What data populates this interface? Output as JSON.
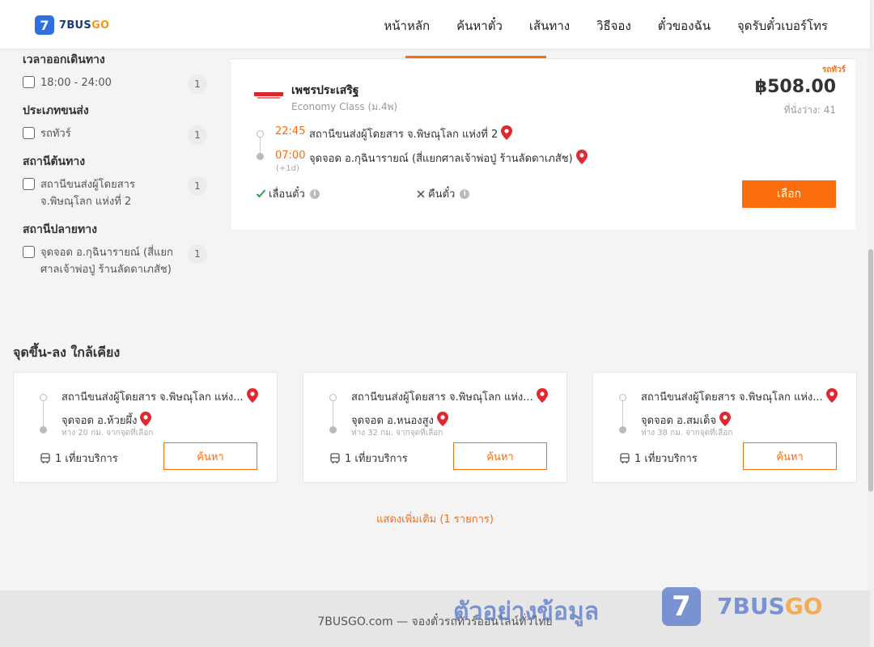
{
  "header": {
    "logo_mark": "7",
    "logo_text": "7BUS",
    "logo_text_go": "GO",
    "nav": [
      "หน้าหลัก",
      "ค้นหาตั๋ว",
      "เส้นทาง",
      "วิธีจอง",
      "ตั๋วของฉัน",
      "จุดรับตั๋วเบอร์โทร"
    ]
  },
  "filters": {
    "departure_time": {
      "title": "เวลาออกเดินทาง",
      "options": [
        {
          "label": "18:00 - 24:00",
          "count": "1"
        }
      ]
    },
    "transport_type": {
      "title": "ประเภทขนส่ง",
      "options": [
        {
          "label": "รถทัวร์",
          "count": "1"
        }
      ]
    },
    "origin_station": {
      "title": "สถานีต้นทาง",
      "options": [
        {
          "label": "สถานีขนส่งผู้โดยสาร จ.พิษณุโลก แห่งที่ 2",
          "count": "1"
        }
      ]
    },
    "destination_station": {
      "title": "สถานีปลายทาง",
      "options": [
        {
          "label": "จุดจอด อ.กุฉินารายณ์ (สี่แยกศาลเจ้าพ่อปู่ ร้านลัดดาเภสัช)",
          "count": "1"
        }
      ]
    }
  },
  "trip": {
    "tag": "รถทัวร์",
    "operator": "เพชรประเสริฐ",
    "bus_class": "Economy Class (ม.4พ)",
    "price": "฿508.00",
    "seats": "ที่นั่งว่าง: 41",
    "depart_time": "22:45",
    "depart_stop": "สถานีขนส่งผู้โดยสาร จ.พิษณุโลก แห่งที่ 2",
    "arrive_time": "07:00",
    "arrive_next_day": "(+1d)",
    "arrive_stop": "จุดจอด อ.กุฉินารายณ์ (สี่แยกศาลเจ้าพ่อปู่ ร้านลัดดาเภสัช)",
    "reschedule": "เลื่อนตั๋ว",
    "refund": "คืนตั๋ว",
    "select_label": "เลือก",
    "brand_color": "#f96d0e"
  },
  "nearby": {
    "title": "จุดขึ้น-ลง ใกล้เคียง",
    "cards": [
      {
        "origin": "สถานีขนส่งผู้โดยสาร จ.พิษณุโลก แห่ง...",
        "dest": "จุดจอด อ.ห้วยผึ้ง",
        "distance": "ห่าง 20 กม. จากจุดที่เลือก",
        "trips": "1 เที่ยวบริการ",
        "button": "ค้นหา"
      },
      {
        "origin": "สถานีขนส่งผู้โดยสาร จ.พิษณุโลก แห่ง...",
        "dest": "จุดจอด อ.หนองสูง",
        "distance": "ห่าง 32 กม. จากจุดที่เลือก",
        "trips": "1 เที่ยวบริการ",
        "button": "ค้นหา"
      },
      {
        "origin": "สถานีขนส่งผู้โดยสาร จ.พิษณุโลก แห่ง...",
        "dest": "จุดจอด อ.สมเด็จ",
        "distance": "ห่าง 38 กม. จากจุดที่เลือก",
        "trips": "1 เที่ยวบริการ",
        "button": "ค้นหา"
      }
    ],
    "show_more": "แสดงเพิ่มเติม (1 รายการ)"
  },
  "footer": {
    "text": "7BUSGO.com — จองตั๋วรถทัวร์ออนไลน์ทั่วไทย",
    "watermark_text": "ตัวอย่างข้อมูล",
    "watermark_mark": "7",
    "watermark_brand": "7BUS",
    "watermark_brand_go": "GO"
  }
}
